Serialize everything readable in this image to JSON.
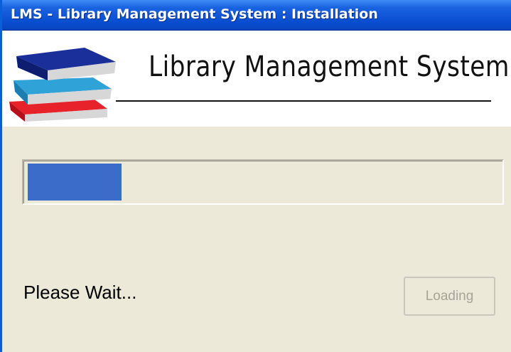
{
  "window": {
    "title": "LMS - Library Management System : Installation"
  },
  "banner": {
    "logo_icon": "books-stack-icon",
    "heading": "Library  Management System"
  },
  "progress": {
    "value_fraction": 0.2,
    "fill_color": "#3b6cc9"
  },
  "status": {
    "message": "Please Wait..."
  },
  "button": {
    "label": "Loading",
    "disabled": true
  },
  "colors": {
    "titlebar": "#0a4fd2",
    "dialog_background": "#ece9d8",
    "book_top": "#1a2f9a",
    "book_middle": "#2fa3d8",
    "book_bottom": "#e8222a",
    "pages": "#d7d7d7"
  }
}
